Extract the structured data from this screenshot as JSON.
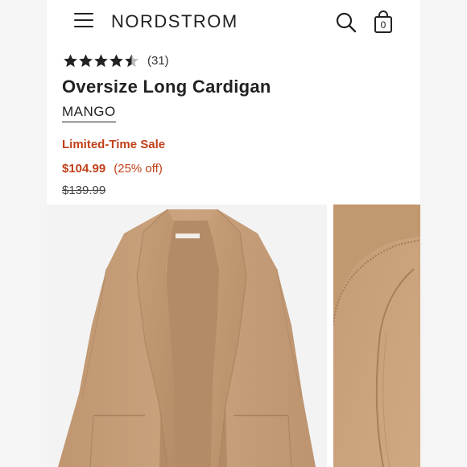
{
  "header": {
    "logo": "NORDSTROM",
    "bag_count": "0",
    "icons": [
      "menu-icon",
      "search-icon",
      "shopping-bag-icon"
    ]
  },
  "product": {
    "rating": 4.5,
    "rating_max": 5,
    "review_count": "(31)",
    "title": "Oversize Long Cardigan",
    "brand": "MANGO",
    "sale_label": "Limited-Time Sale",
    "sale_price": "$104.99",
    "discount": "(25% off)",
    "original_price": "$139.99"
  },
  "colors": {
    "sale_red": "#c2401a",
    "text_dark": "#222222",
    "cardigan_camel": "#c9a07a",
    "star_fill": "#222222",
    "star_empty": "#bbbbbb"
  },
  "images": [
    "cardigan-front-photo",
    "cardigan-fabric-detail-photo"
  ]
}
